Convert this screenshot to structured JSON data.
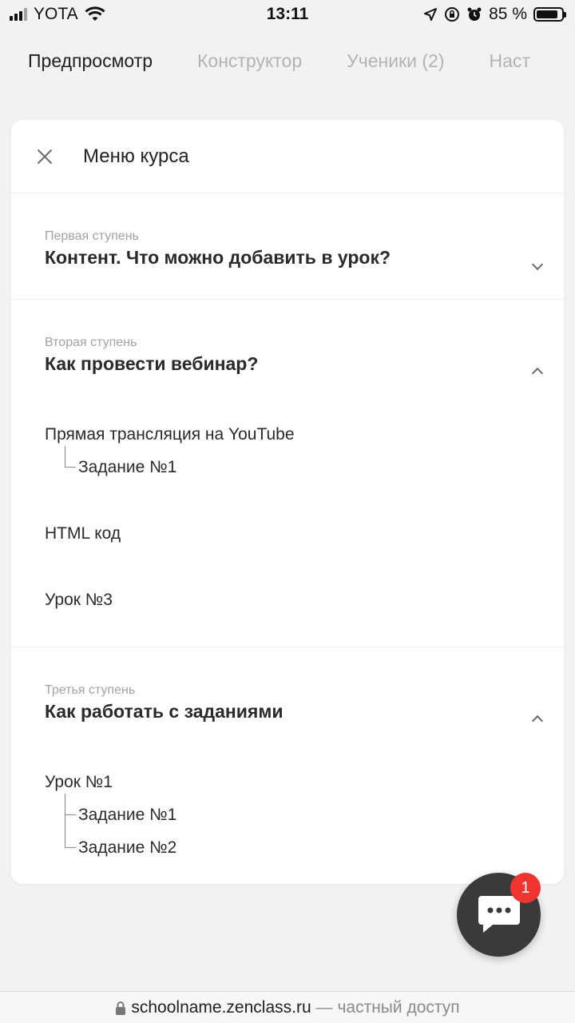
{
  "status_bar": {
    "carrier": "YOTA",
    "time": "13:11",
    "battery_text": "85 %",
    "battery_level": 0.85
  },
  "tabs": [
    {
      "label": "Предпросмотр",
      "active": true
    },
    {
      "label": "Конструктор",
      "active": false
    },
    {
      "label": "Ученики (2)",
      "active": false
    },
    {
      "label": "Наст",
      "active": false
    }
  ],
  "menu": {
    "title": "Меню курса",
    "sections": [
      {
        "subtitle": "Первая ступень",
        "title": "Контент. Что можно добавить в урок?",
        "expanded": false
      },
      {
        "subtitle": "Вторая ступень",
        "title": "Как провести вебинар?",
        "expanded": true,
        "lessons": [
          {
            "title": "Прямая трансляция на YouTube",
            "tasks": [
              "Задание №1"
            ]
          },
          {
            "title": "HTML код"
          },
          {
            "title": "Урок №3"
          }
        ]
      },
      {
        "subtitle": "Третья ступень",
        "title": "Как работать с заданиями",
        "expanded": true,
        "lessons": [
          {
            "title": "Урок №1",
            "tasks": [
              "Задание №1",
              "Задание №2"
            ]
          }
        ]
      }
    ]
  },
  "chat": {
    "badge_count": "1",
    "icon": "chat-bubble-icon"
  },
  "url_bar": {
    "host": "schoolname.zenclass.ru",
    "note": "— частный доступ",
    "icon": "lock-icon"
  },
  "colors": {
    "badge": "#f0352f",
    "chat_button": "#3a3a3a"
  }
}
